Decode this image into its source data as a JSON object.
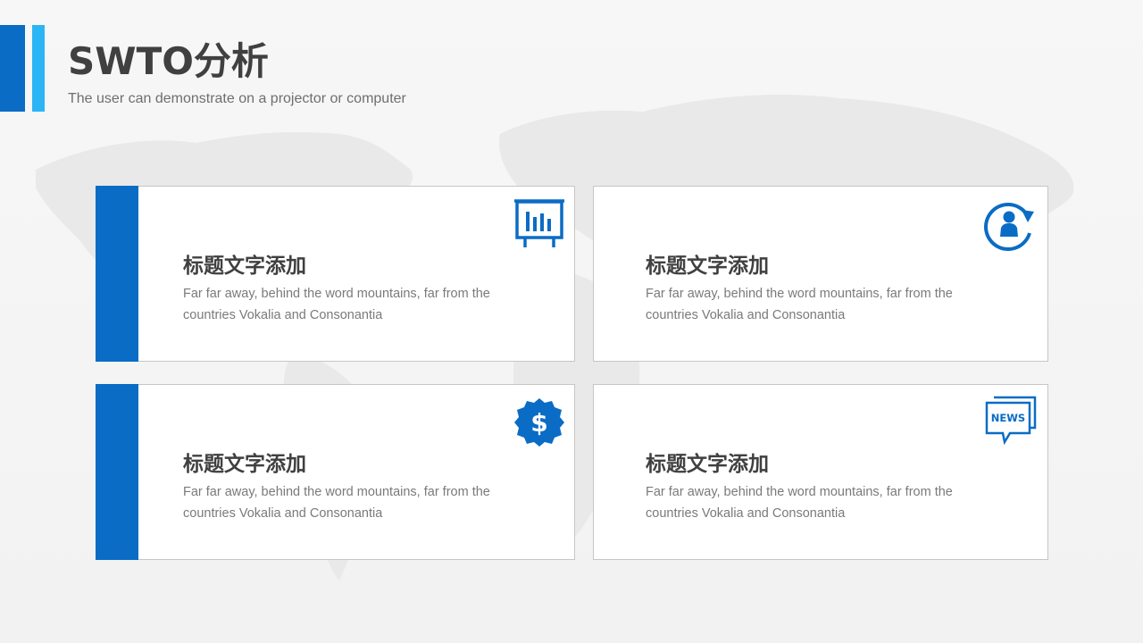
{
  "header": {
    "title": "SWTO分析",
    "subtitle": "The user can demonstrate on a projector or computer"
  },
  "colors": {
    "accent_dark": "#0a6cc5",
    "accent_light": "#2bb5f5",
    "text_dark": "#404040",
    "text_muted": "#7a7a7a"
  },
  "cards": [
    {
      "title": "标题文字添加",
      "description": "Far far away, behind the word mountains, far from the countries Vokalia and Consonantia",
      "icon": "presentation-board-icon",
      "has_side_stripe": true
    },
    {
      "title": "标题文字添加",
      "description": "Far far away, behind the word mountains, far from the countries Vokalia and Consonantia",
      "icon": "user-refresh-icon",
      "has_side_stripe": false
    },
    {
      "title": "标题文字添加",
      "description": "Far far away, behind the word mountains, far from the countries Vokalia and Consonantia",
      "icon": "dollar-badge-icon",
      "has_side_stripe": true
    },
    {
      "title": "标题文字添加",
      "description": "Far far away, behind the word mountains, far from the countries Vokalia and Consonantia",
      "icon": "news-chat-icon",
      "icon_text": "NEWS",
      "has_side_stripe": false
    }
  ]
}
